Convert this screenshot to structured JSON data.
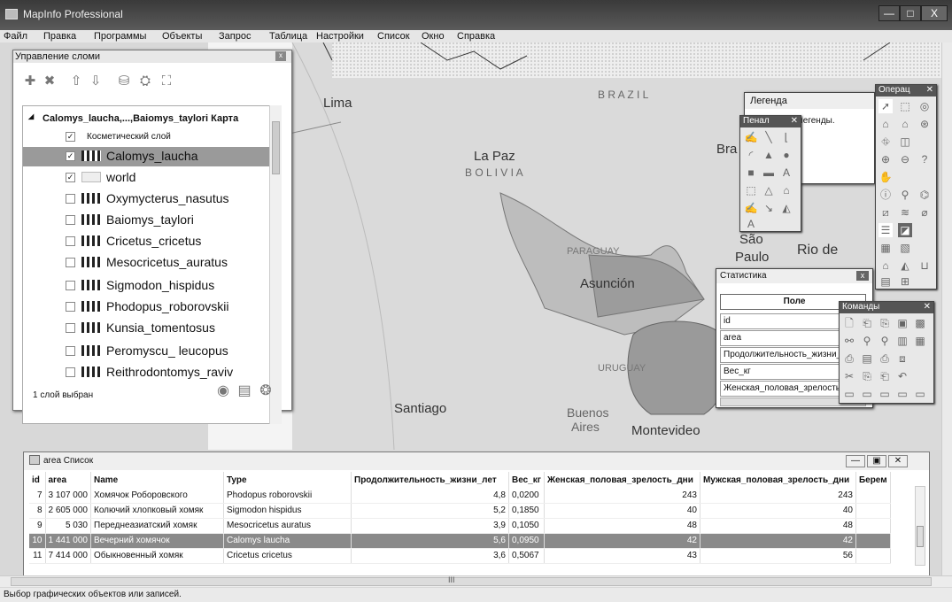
{
  "window": {
    "title": "MapInfo Professional",
    "min": "—",
    "max": "□",
    "close": "X"
  },
  "menu": [
    "Файл",
    "Правка",
    "Программы",
    "Объекты",
    "Запрос",
    "Таблица",
    "Настройки",
    "Список",
    "Окно",
    "Справка"
  ],
  "layer_control": {
    "title": "Управление сломи",
    "map_name": "Calomys_laucha,...,Baiomys_taylori Карта",
    "layers": [
      {
        "name": "Косметический слой",
        "checked": true,
        "selected": false,
        "small": true
      },
      {
        "name": "Calomys_laucha",
        "checked": true,
        "selected": true
      },
      {
        "name": "world",
        "checked": true,
        "selected": false
      },
      {
        "name": "Oxymycterus_nasutus",
        "checked": false,
        "selected": false
      },
      {
        "name": "Baiomys_taylori",
        "checked": false,
        "selected": false
      },
      {
        "name": "Cricetus_cricetus",
        "checked": false,
        "selected": false
      },
      {
        "name": "Mesocricetus_auratus",
        "checked": false,
        "selected": false
      },
      {
        "name": "Sigmodon_hispidus",
        "checked": false,
        "selected": false
      },
      {
        "name": "Phodopus_roborovskii",
        "checked": false,
        "selected": false
      },
      {
        "name": "Kunsia_tomentosus",
        "checked": false,
        "selected": false
      },
      {
        "name": "Peromyscu_ leucopus",
        "checked": false,
        "selected": false
      },
      {
        "name": "Reithrodontomys_raviv",
        "checked": false,
        "selected": false
      }
    ],
    "status": "1 слой выбран"
  },
  "map_labels": {
    "lima": "Lima",
    "lapaz": "La Paz",
    "bolivia": "B O L I V I A",
    "brazil": "B R A Z I L",
    "bra": "Bra",
    "sao": "São",
    "paulo": "Paulo",
    "rio": "Rio de",
    "paraguay": "PARAGUAY",
    "asuncion": "Asunción",
    "uruguay": "URUGUAY",
    "santiago": "Santiago",
    "buenos": "Buenos",
    "aires": "Aires",
    "montevideo": "Montevideo"
  },
  "legend": {
    "title": "Легенда",
    "text": "ой легенды."
  },
  "penal": {
    "title": "Пенал",
    "close": "✕"
  },
  "operations": {
    "title": "Операц",
    "close": "✕"
  },
  "commands": {
    "title": "Команды",
    "close": "✕"
  },
  "statistics": {
    "title": "Статистика",
    "field_header": "Поле",
    "fields": [
      "id",
      "area",
      "Продолжительность_жизни_",
      "Вес_кг",
      "Женская_половая_зрелость"
    ]
  },
  "list": {
    "title": "area Список",
    "columns": [
      "id",
      "area",
      "Name",
      "Type",
      "Продолжительность_жизни_лет",
      "Вес_кг",
      "Женская_половая_зрелость_дни",
      "Мужская_половая_зрелость_дни",
      "Берем"
    ],
    "rows": [
      [
        "7",
        "3 107 000",
        "Хомячок Роборовского",
        "Phodopus roborovskii",
        "4,8",
        "0,0200",
        "243",
        "243",
        ""
      ],
      [
        "8",
        "2 605 000",
        "Колючий хлопковый хомяк",
        "Sigmodon hispidus",
        "5,2",
        "0,1850",
        "40",
        "40",
        ""
      ],
      [
        "9",
        "5 030",
        "Переднеазиатский хомяк",
        "Mesocricetus auratus",
        "3,9",
        "0,1050",
        "48",
        "48",
        ""
      ],
      [
        "10",
        "1 441 000",
        "Вечерний хомячок",
        "Calomys laucha",
        "5,6",
        "0,0950",
        "42",
        "42",
        ""
      ],
      [
        "11",
        "7 414 000",
        "Обыкновенный хомяк",
        "Cricetus cricetus",
        "3,6",
        "0,5067",
        "43",
        "56",
        ""
      ]
    ],
    "highlighted_row": 3
  },
  "hscroll_mark": "III",
  "status_bar": "Выбор графических объектов или записей."
}
